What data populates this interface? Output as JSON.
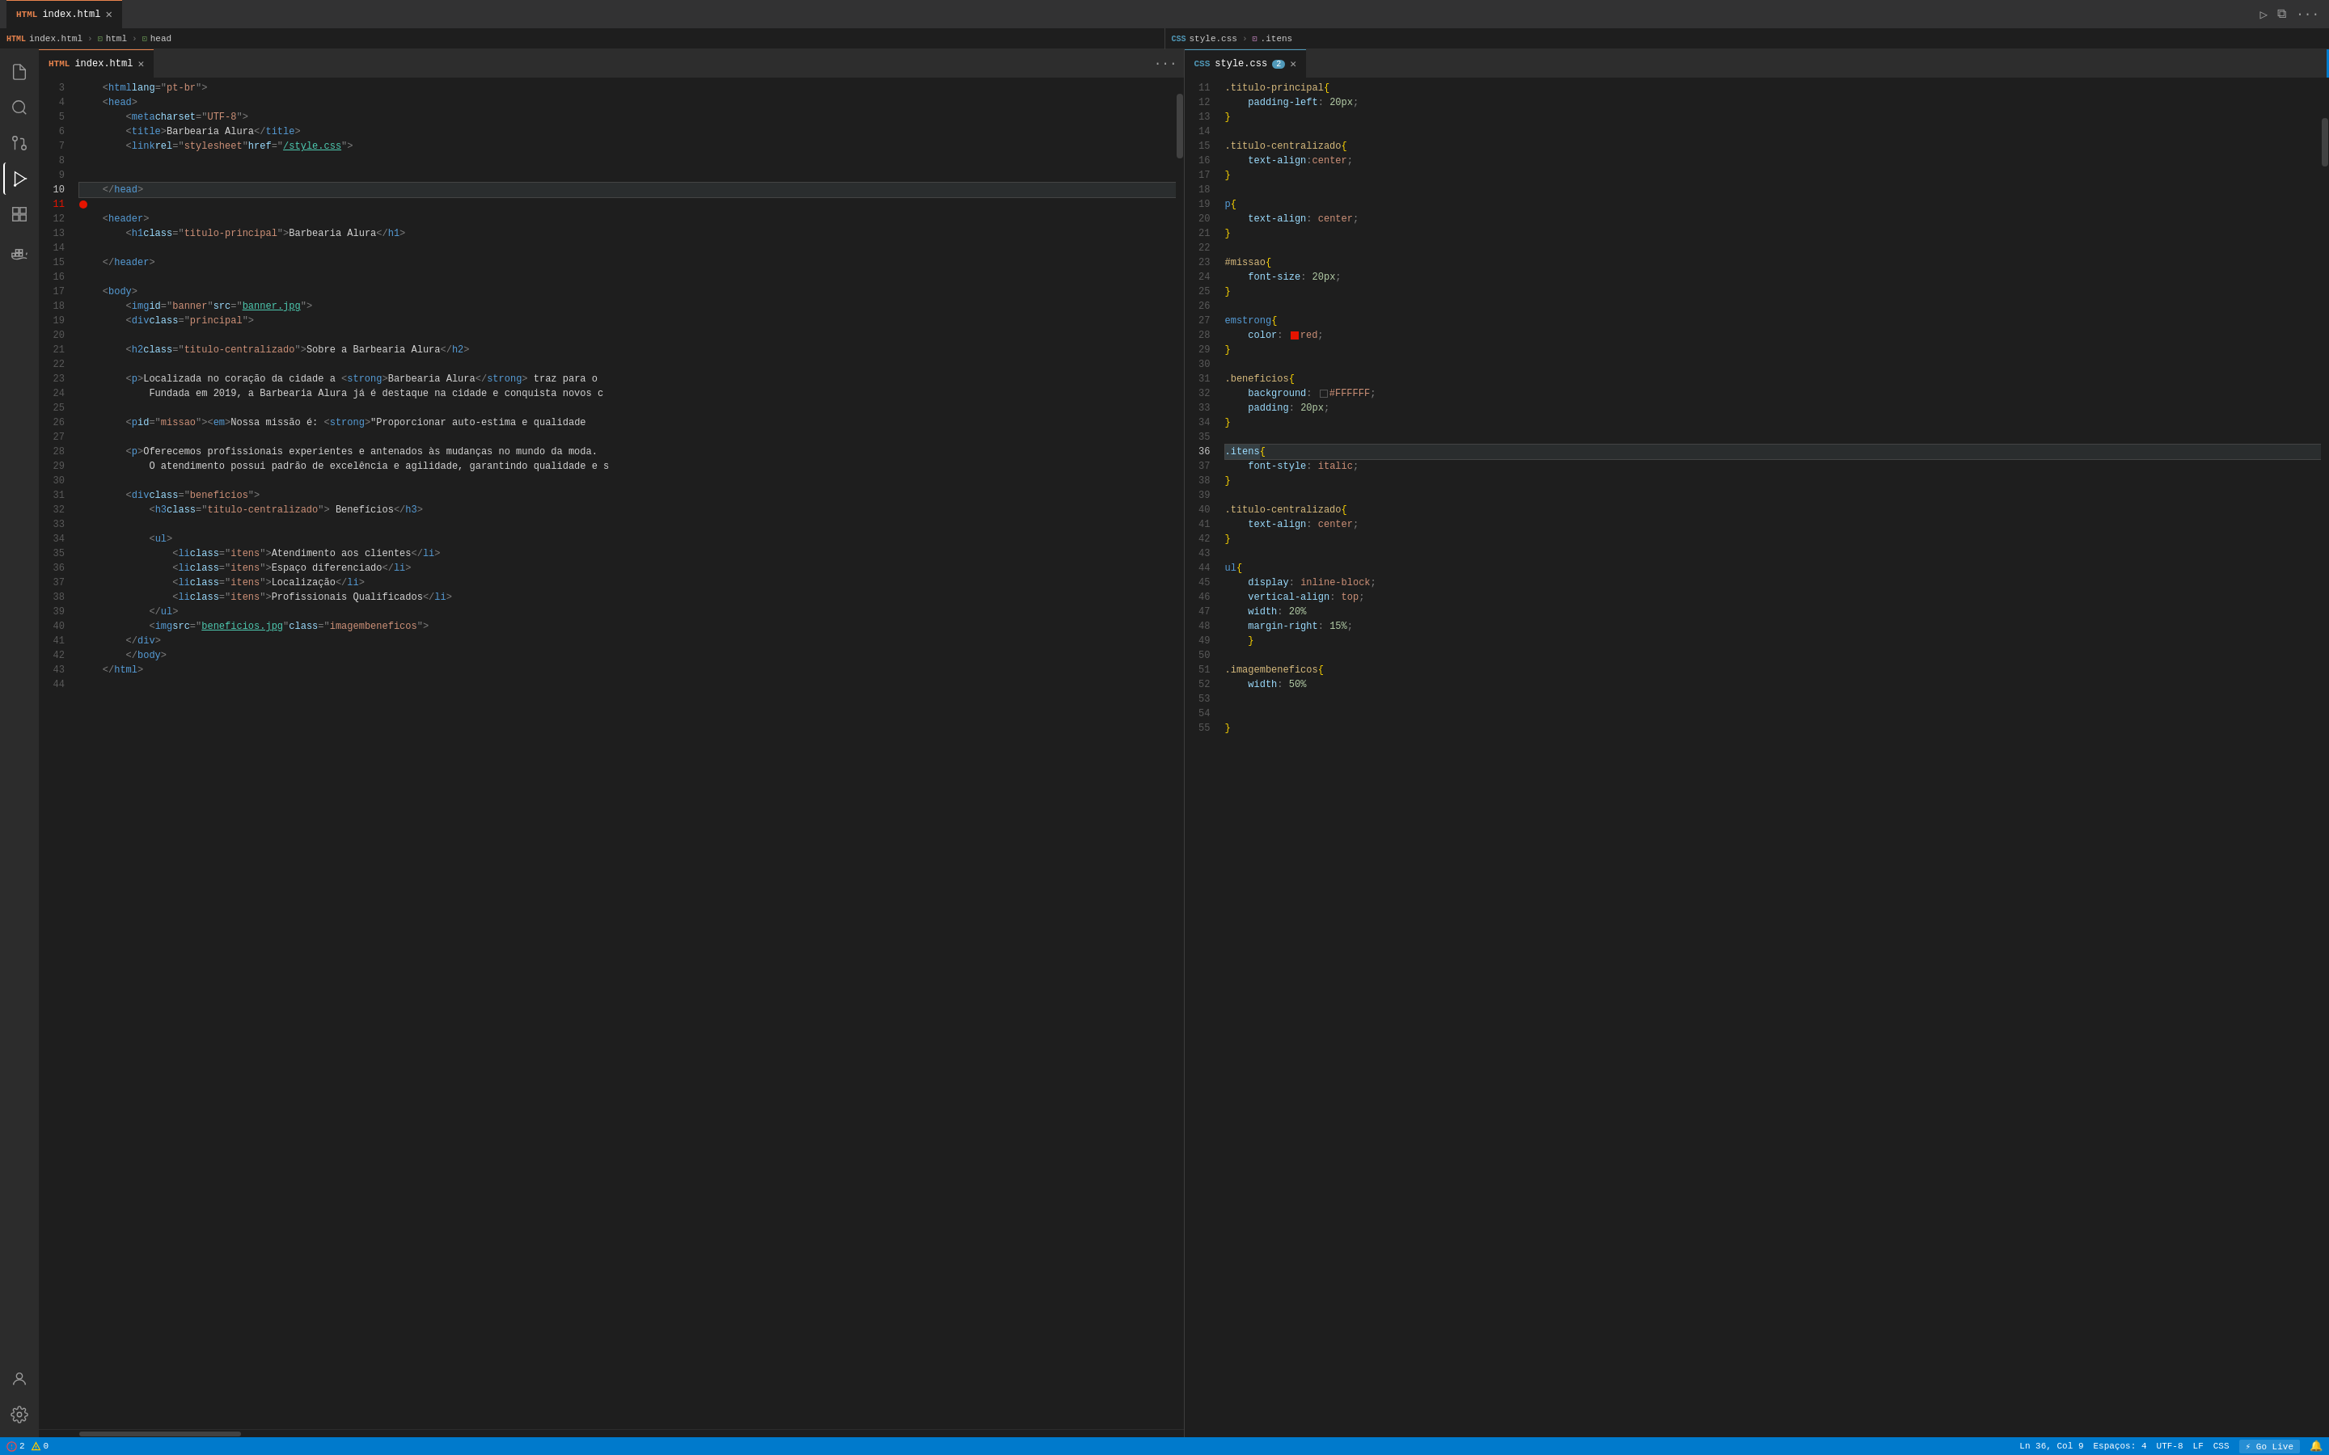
{
  "tabs": {
    "left": [
      {
        "id": "index-html",
        "label": "index.html",
        "icon": "html",
        "active": true,
        "modified": false
      },
      {
        "id": "style-css",
        "label": "style.css",
        "icon": "css",
        "active": false,
        "modified": false
      }
    ],
    "right": [
      {
        "id": "style-css-right",
        "label": "style.css",
        "icon": "css",
        "active": true,
        "badge": "2"
      }
    ]
  },
  "breadcrumbs": {
    "left": [
      "index.html",
      "html",
      "head"
    ],
    "right": [
      "style.css",
      ".itens"
    ]
  },
  "html_code": [
    {
      "ln": 3,
      "content": "    <html lang=\"pt-br\">"
    },
    {
      "ln": 4,
      "content": "    <head>"
    },
    {
      "ln": 5,
      "content": "        <meta charset=\"UTF-8\">"
    },
    {
      "ln": 6,
      "content": "        <title>Barbearia Alura</title>"
    },
    {
      "ln": 7,
      "content": "        <link rel=\"stylesheet\" href=\"/style.css\">"
    },
    {
      "ln": 8,
      "content": ""
    },
    {
      "ln": 9,
      "content": ""
    },
    {
      "ln": 10,
      "content": "    </head>",
      "current": true
    },
    {
      "ln": 11,
      "content": "",
      "breakpoint": true
    },
    {
      "ln": 12,
      "content": "    <header>"
    },
    {
      "ln": 13,
      "content": "        <h1 class=\"titulo-principal\">Barbearia Alura</h1>"
    },
    {
      "ln": 14,
      "content": ""
    },
    {
      "ln": 15,
      "content": "    </header>"
    },
    {
      "ln": 16,
      "content": ""
    },
    {
      "ln": 17,
      "content": "    <body>"
    },
    {
      "ln": 18,
      "content": "        <img id=\"banner\" src=\"banner.jpg\">"
    },
    {
      "ln": 19,
      "content": "        <div class=\"principal\">"
    },
    {
      "ln": 20,
      "content": ""
    },
    {
      "ln": 21,
      "content": "        <h2 class=\"titulo-centralizado\">Sobre a Barbearia Alura</h2>"
    },
    {
      "ln": 22,
      "content": ""
    },
    {
      "ln": 23,
      "content": "        <p>Localizada no coração da cidade a <strong>Barbearia Alura</strong> traz para o"
    },
    {
      "ln": 24,
      "content": "            Fundada em 2019, a Barbearia Alura já é destaque na cidade e conquista novos c"
    },
    {
      "ln": 25,
      "content": ""
    },
    {
      "ln": 26,
      "content": "        <p id=\"missao\" ><em>Nossa missão é: <strong>\"Proporcionar auto-estima e qualidade"
    },
    {
      "ln": 27,
      "content": ""
    },
    {
      "ln": 28,
      "content": "        <p>Oferecemos profissionais experientes e antenados às mudanças no mundo da moda."
    },
    {
      "ln": 29,
      "content": "            O atendimento possui padrão de excelência e agilidade, garantindo qualidade e s"
    },
    {
      "ln": 30,
      "content": ""
    },
    {
      "ln": 31,
      "content": "        <div class=\"beneficios\">"
    },
    {
      "ln": 32,
      "content": "            <h3 class=\"titulo-centralizado\"> Benefícios</h3>"
    },
    {
      "ln": 33,
      "content": ""
    },
    {
      "ln": 34,
      "content": "            <ul>"
    },
    {
      "ln": 35,
      "content": "                <li class=\"itens\">Atendimento aos clientes</li>"
    },
    {
      "ln": 36,
      "content": "                <li class=\"itens\">Espaço diferenciado</li>"
    },
    {
      "ln": 37,
      "content": "                <li class=\"itens\">Localização</li>"
    },
    {
      "ln": 38,
      "content": "                <li class=\"itens\">Profissionais Qualificados</li>"
    },
    {
      "ln": 39,
      "content": "            </ul>"
    },
    {
      "ln": 40,
      "content": "            <img src=\"beneficios.jpg\" class=\"imagembeneficos\">"
    },
    {
      "ln": 41,
      "content": "        </div>"
    },
    {
      "ln": 42,
      "content": "        </body>"
    },
    {
      "ln": 43,
      "content": "    </html>"
    },
    {
      "ln": 44,
      "content": ""
    }
  ],
  "css_code": [
    {
      "ln": 11,
      "content": ".titulo-principal {"
    },
    {
      "ln": 12,
      "content": "    padding-left: 20px;"
    },
    {
      "ln": 13,
      "content": "}"
    },
    {
      "ln": 14,
      "content": ""
    },
    {
      "ln": 15,
      "content": ".titulo-centralizado {"
    },
    {
      "ln": 16,
      "content": "    text-align:center;"
    },
    {
      "ln": 17,
      "content": "}"
    },
    {
      "ln": 18,
      "content": ""
    },
    {
      "ln": 19,
      "content": "p {"
    },
    {
      "ln": 20,
      "content": "    text-align: center;"
    },
    {
      "ln": 21,
      "content": "}"
    },
    {
      "ln": 22,
      "content": ""
    },
    {
      "ln": 23,
      "content": "#missao {"
    },
    {
      "ln": 24,
      "content": "    font-size: 20px;"
    },
    {
      "ln": 25,
      "content": "}"
    },
    {
      "ln": 26,
      "content": ""
    },
    {
      "ln": 27,
      "content": "em strong{"
    },
    {
      "ln": 28,
      "content": "    color: ■red;"
    },
    {
      "ln": 29,
      "content": "}"
    },
    {
      "ln": 30,
      "content": ""
    },
    {
      "ln": 31,
      "content": ".beneficios {"
    },
    {
      "ln": 32,
      "content": "    background: ■#FFFFFF;"
    },
    {
      "ln": 33,
      "content": "    padding: 20px;"
    },
    {
      "ln": 34,
      "content": "}"
    },
    {
      "ln": 35,
      "content": ""
    },
    {
      "ln": 36,
      "content": ".itens {",
      "current": true
    },
    {
      "ln": 37,
      "content": "    font-style: italic;"
    },
    {
      "ln": 38,
      "content": "}"
    },
    {
      "ln": 39,
      "content": ""
    },
    {
      "ln": 40,
      "content": ".titulo-centralizado {"
    },
    {
      "ln": 41,
      "content": "    text-align: center;"
    },
    {
      "ln": 42,
      "content": "}"
    },
    {
      "ln": 43,
      "content": ""
    },
    {
      "ln": 44,
      "content": "ul {"
    },
    {
      "ln": 45,
      "content": "    display: inline-block;"
    },
    {
      "ln": 46,
      "content": "    vertical-align: top;"
    },
    {
      "ln": 47,
      "content": "    width: 20%"
    },
    {
      "ln": 48,
      "content": "    margin-right: 15%;"
    },
    {
      "ln": 49,
      "content": "    }"
    },
    {
      "ln": 50,
      "content": ""
    },
    {
      "ln": 51,
      "content": ".imagembeneficos {"
    },
    {
      "ln": 52,
      "content": "    width: 50%"
    },
    {
      "ln": 53,
      "content": ""
    },
    {
      "ln": 54,
      "content": ""
    },
    {
      "ln": 55,
      "content": "}"
    }
  ],
  "status_bar": {
    "errors": "2",
    "warnings": "0",
    "position": "Ln 36, Col 9",
    "spaces": "Espaços: 4",
    "encoding": "UTF-8",
    "line_ending": "LF",
    "language": "CSS",
    "go_live": "⚡ Go Live"
  },
  "activity_bar": {
    "icons": [
      {
        "name": "files-icon",
        "symbol": "⎘",
        "active": false
      },
      {
        "name": "search-icon",
        "symbol": "🔍",
        "active": false
      },
      {
        "name": "source-control-icon",
        "symbol": "⑂",
        "active": false
      },
      {
        "name": "run-debug-icon",
        "symbol": "▷",
        "active": true
      },
      {
        "name": "extensions-icon",
        "symbol": "⊞",
        "active": false
      }
    ],
    "bottom_icons": [
      {
        "name": "account-icon",
        "symbol": "👤"
      },
      {
        "name": "settings-icon",
        "symbol": "⚙"
      }
    ]
  }
}
